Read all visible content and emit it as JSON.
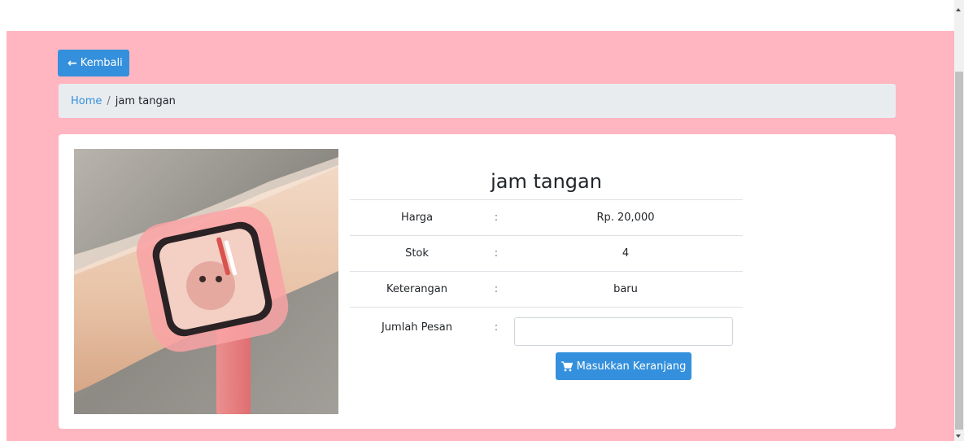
{
  "nav": {
    "back_label": "Kembali"
  },
  "breadcrumb": {
    "home": "Home",
    "separator": "/",
    "current": "jam tangan"
  },
  "product": {
    "name": "jam tangan",
    "rows": [
      {
        "label": "Harga",
        "colon": ":",
        "value": "Rp. 20,000"
      },
      {
        "label": "Stok",
        "colon": ":",
        "value": "4"
      },
      {
        "label": "Keterangan",
        "colon": ":",
        "value": "baru"
      }
    ],
    "quantity": {
      "label": "Jumlah Pesan",
      "colon": ":",
      "value": "",
      "placeholder": ""
    },
    "add_to_cart_label": "Masukkan Keranjang"
  },
  "colors": {
    "page_bg": "#ffb6c1",
    "primary": "#3490dc",
    "breadcrumb_bg": "#e9ecef"
  },
  "icons": {
    "back": "arrow-left-icon",
    "cart": "cart-icon"
  }
}
